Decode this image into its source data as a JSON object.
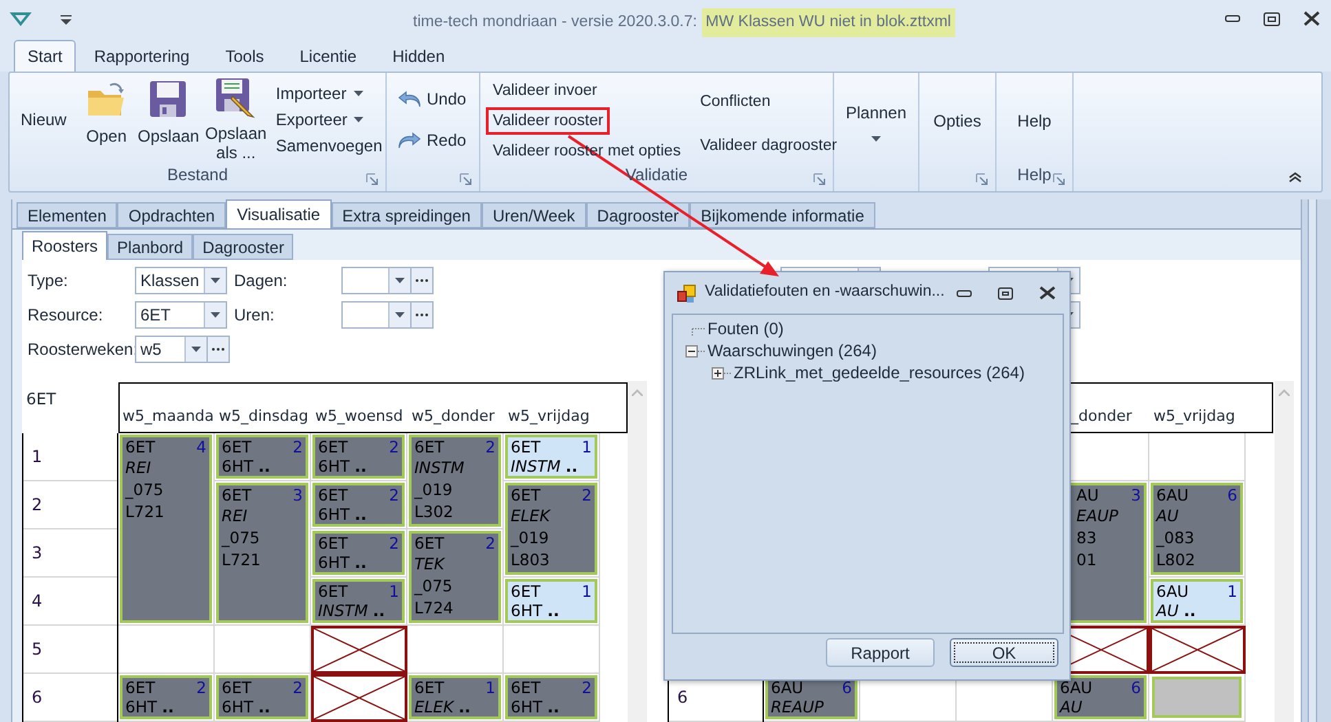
{
  "window": {
    "title": "time-tech mondriaan - versie 2020.3.0.7: ",
    "file": "MW Klassen WU niet in blok.zttxml",
    "file_highlighted": true
  },
  "ribbon": {
    "tabs": [
      {
        "label": "Start",
        "selected": true
      },
      {
        "label": "Rapportering",
        "selected": false
      },
      {
        "label": "Tools",
        "selected": false
      },
      {
        "label": "Licentie",
        "selected": false
      },
      {
        "label": "Hidden",
        "selected": false
      }
    ],
    "file_group": {
      "label": "Bestand",
      "new": "Nieuw",
      "open": "Open",
      "save": "Opslaan",
      "save_as": "Opslaan als ...",
      "commands": [
        {
          "label": "Importeer",
          "dropdown": true
        },
        {
          "label": "Exporteer",
          "dropdown": true
        },
        {
          "label": "Samenvoegen",
          "dropdown": false
        }
      ]
    },
    "edit_group": {
      "undo": "Undo",
      "redo": "Redo"
    },
    "validation_group": {
      "label": "Validatie",
      "commands": [
        {
          "label": "Valideer invoer",
          "highlighted": false
        },
        {
          "label": "Valideer rooster",
          "highlighted": true
        },
        {
          "label": "Valideer rooster met opties",
          "highlighted": false
        },
        {
          "label": "Conflicten",
          "highlighted": false
        },
        {
          "label": "Valideer dagrooster",
          "highlighted": false
        }
      ]
    },
    "plan_group": {
      "button": "Plannen"
    },
    "options_group": {
      "button": "Opties"
    },
    "help_group": {
      "button": "Help",
      "label": "Help"
    }
  },
  "tabs": [
    {
      "label": "Elementen",
      "selected": false
    },
    {
      "label": "Opdrachten",
      "selected": false
    },
    {
      "label": "Visualisatie",
      "selected": true
    },
    {
      "label": "Extra spreidingen",
      "selected": false
    },
    {
      "label": "Uren/Week",
      "selected": false
    },
    {
      "label": "Dagrooster",
      "selected": false
    },
    {
      "label": "Bijkomende informatie",
      "selected": false
    }
  ],
  "subtabs": [
    {
      "label": "Roosters",
      "selected": true
    },
    {
      "label": "Planbord",
      "selected": false
    },
    {
      "label": "Dagrooster",
      "selected": false
    }
  ],
  "filter_rows": [
    [
      {
        "label": "Type:",
        "value": "Klassen",
        "browse": false
      },
      {
        "label": "Dagen:",
        "browse": true
      }
    ],
    [
      {
        "label": "Resource:",
        "value": "6ET",
        "browse": false
      },
      {
        "label": "Uren:",
        "browse": true
      }
    ],
    [
      {
        "label": "Roosterweken:",
        "value": "w5",
        "browse": true
      }
    ]
  ],
  "right_filters": [
    {
      "kind": "combo"
    },
    {
      "kind": "combo"
    },
    {
      "kind": "combo"
    }
  ],
  "left_timetable": {
    "corner": "6ET",
    "periods": [
      {
        "label": "1"
      },
      {
        "label": "2"
      },
      {
        "label": "3"
      },
      {
        "label": "4"
      },
      {
        "label": "5"
      },
      {
        "label": "6"
      }
    ],
    "days": [
      {
        "header": "w5_maanda",
        "entries": [
          {
            "kind": "lesson",
            "light": false,
            "class": "6ET",
            "count": "4",
            "lines": [
              {
                "text": "REI",
                "italic": true
              },
              {
                "text": "_075",
                "italic": false
              },
              {
                "text": "L721",
                "italic": false
              }
            ]
          },
          {
            "kind": "continuation"
          },
          {
            "kind": "continuation"
          },
          {
            "kind": "continuation"
          },
          {
            "kind": "empty"
          },
          {
            "kind": "lesson",
            "light": false,
            "class": "6ET",
            "count": "2",
            "lines": [
              {
                "text": "6HT **..**",
                "italic": false
              }
            ]
          }
        ]
      },
      {
        "header": "w5_dinsdag",
        "entries": [
          {
            "kind": "lesson",
            "light": false,
            "class": "6ET",
            "count": "2",
            "lines": [
              {
                "text": "6HT **..**",
                "italic": false
              }
            ]
          },
          {
            "kind": "lesson",
            "light": false,
            "class": "6ET",
            "count": "3",
            "lines": [
              {
                "text": "REI",
                "italic": true
              },
              {
                "text": "_075",
                "italic": false
              },
              {
                "text": "L721",
                "italic": false
              }
            ]
          },
          {
            "kind": "continuation"
          },
          {
            "kind": "continuation"
          },
          {
            "kind": "empty"
          },
          {
            "kind": "lesson",
            "light": false,
            "class": "6ET",
            "count": "2",
            "lines": [
              {
                "text": "6HT **..**",
                "italic": false
              }
            ]
          }
        ]
      },
      {
        "header": "w5_woensd",
        "entries": [
          {
            "kind": "lesson",
            "light": false,
            "class": "6ET",
            "count": "2",
            "lines": [
              {
                "text": "6HT **..**",
                "italic": false
              }
            ]
          },
          {
            "kind": "lesson",
            "light": false,
            "class": "6ET",
            "count": "2",
            "lines": [
              {
                "text": "6HT **..**",
                "italic": false
              }
            ]
          },
          {
            "kind": "lesson",
            "light": false,
            "class": "6ET",
            "count": "2",
            "lines": [
              {
                "text": "6HT **..**",
                "italic": false
              }
            ]
          },
          {
            "kind": "lesson",
            "light": false,
            "class": "6ET",
            "count": "1",
            "lines": [
              {
                "text": "*INSTM* **..**",
                "italic": false
              }
            ]
          },
          {
            "kind": "blocked"
          },
          {
            "kind": "blocked"
          }
        ]
      },
      {
        "header": "w5_donder",
        "entries": [
          {
            "kind": "lesson",
            "light": false,
            "class": "6ET",
            "count": "2",
            "lines": [
              {
                "text": "INSTM",
                "italic": true
              },
              {
                "text": "_019",
                "italic": false
              },
              {
                "text": "L302",
                "italic": false
              }
            ]
          },
          {
            "kind": "continuation"
          },
          {
            "kind": "lesson",
            "light": false,
            "class": "6ET",
            "count": "2",
            "lines": [
              {
                "text": "TEK",
                "italic": true
              },
              {
                "text": "_075",
                "italic": false
              },
              {
                "text": "L724",
                "italic": false
              }
            ]
          },
          {
            "kind": "continuation"
          },
          {
            "kind": "empty"
          },
          {
            "kind": "lesson",
            "light": false,
            "class": "6ET",
            "count": "1",
            "lines": [
              {
                "text": "*ELEK* **..**",
                "italic": false
              }
            ]
          }
        ]
      },
      {
        "header": "w5_vrijdag",
        "entries": [
          {
            "kind": "lesson",
            "light": true,
            "class": "6ET",
            "count": "1",
            "lines": [
              {
                "text": "*INSTM* **..**",
                "italic": false
              }
            ]
          },
          {
            "kind": "lesson",
            "light": false,
            "class": "6ET",
            "count": "2",
            "lines": [
              {
                "text": "ELEK",
                "italic": true
              },
              {
                "text": "_019",
                "italic": false
              },
              {
                "text": "L803",
                "italic": false
              }
            ]
          },
          {
            "kind": "continuation"
          },
          {
            "kind": "lesson",
            "light": true,
            "class": "6ET",
            "count": "1",
            "lines": [
              {
                "text": "6HT **..**",
                "italic": false
              }
            ]
          },
          {
            "kind": "empty"
          },
          {
            "kind": "lesson",
            "light": false,
            "class": "6ET",
            "count": "2",
            "lines": [
              {
                "text": "6HT **..**",
                "italic": false
              }
            ]
          }
        ]
      }
    ]
  },
  "right_timetable": {
    "periods": [
      {
        "label": "6"
      }
    ],
    "days": [
      {
        "entries": [
          {
            "kind": "covered"
          },
          {
            "kind": "covered"
          },
          {
            "kind": "covered"
          },
          {
            "kind": "covered"
          },
          {
            "kind": "covered"
          },
          {
            "kind": "lesson",
            "light": false,
            "covered": false,
            "class": "6AU",
            "count": "6",
            "lines": [
              {
                "text": "REAUP",
                "italic": true
              }
            ]
          }
        ]
      },
      {
        "entries": [
          {
            "kind": "covered"
          },
          {
            "kind": "covered"
          },
          {
            "kind": "covered"
          },
          {
            "kind": "covered"
          },
          {
            "kind": "covered"
          },
          {
            "kind": "empty"
          }
        ]
      },
      {
        "entries": [
          {
            "kind": "covered"
          },
          {
            "kind": "covered"
          },
          {
            "kind": "covered"
          },
          {
            "kind": "covered"
          },
          {
            "kind": "covered"
          },
          {
            "kind": "empty"
          }
        ]
      },
      {
        "header": "_donder",
        "covered": true,
        "entries": [
          {
            "kind": "empty"
          },
          {
            "kind": "lesson",
            "light": false,
            "covered": true,
            "class": "AU",
            "count": "3",
            "lines": [
              {
                "text": "EAUP",
                "italic": true
              },
              {
                "text": "83",
                "italic": false
              },
              {
                "text": "01",
                "italic": false
              }
            ]
          },
          {
            "kind": "continuation"
          },
          {
            "kind": "continuation"
          },
          {
            "kind": "blocked"
          },
          {
            "kind": "lesson",
            "light": false,
            "covered": false,
            "class": "6AU",
            "count": "6",
            "lines": [
              {
                "text": "AU",
                "italic": true
              }
            ]
          }
        ]
      },
      {
        "header": "w5_vrijdag",
        "covered": false,
        "entries": [
          {
            "kind": "empty"
          },
          {
            "kind": "lesson",
            "light": false,
            "covered": false,
            "class": "6AU",
            "count": "6",
            "lines": [
              {
                "text": "AU",
                "italic": true
              },
              {
                "text": "_083",
                "italic": false
              },
              {
                "text": "L802",
                "italic": false
              }
            ]
          },
          {
            "kind": "continuation"
          },
          {
            "kind": "lesson",
            "light": true,
            "covered": false,
            "class": "6AU",
            "count": "1",
            "lines": [
              {
                "text": "*AU* **..**",
                "italic": false
              }
            ]
          },
          {
            "kind": "blocked"
          },
          {
            "kind": "grey"
          }
        ]
      }
    ]
  },
  "dialog": {
    "title": "Validatiefouten en -waarschuwin...",
    "tree": [
      {
        "kind": "leaf",
        "label": "Fouten (0)"
      },
      {
        "kind": "branch",
        "label": "Waarschuwingen (264)",
        "expanded": true,
        "children": [
          {
            "kind": "branch",
            "label": "ZRLink_met_gedeelde_resources (264)",
            "expanded": false
          }
        ]
      }
    ],
    "buttons": [
      {
        "label": "Rapport",
        "focused": false
      },
      {
        "label": "OK",
        "focused": true
      }
    ]
  }
}
